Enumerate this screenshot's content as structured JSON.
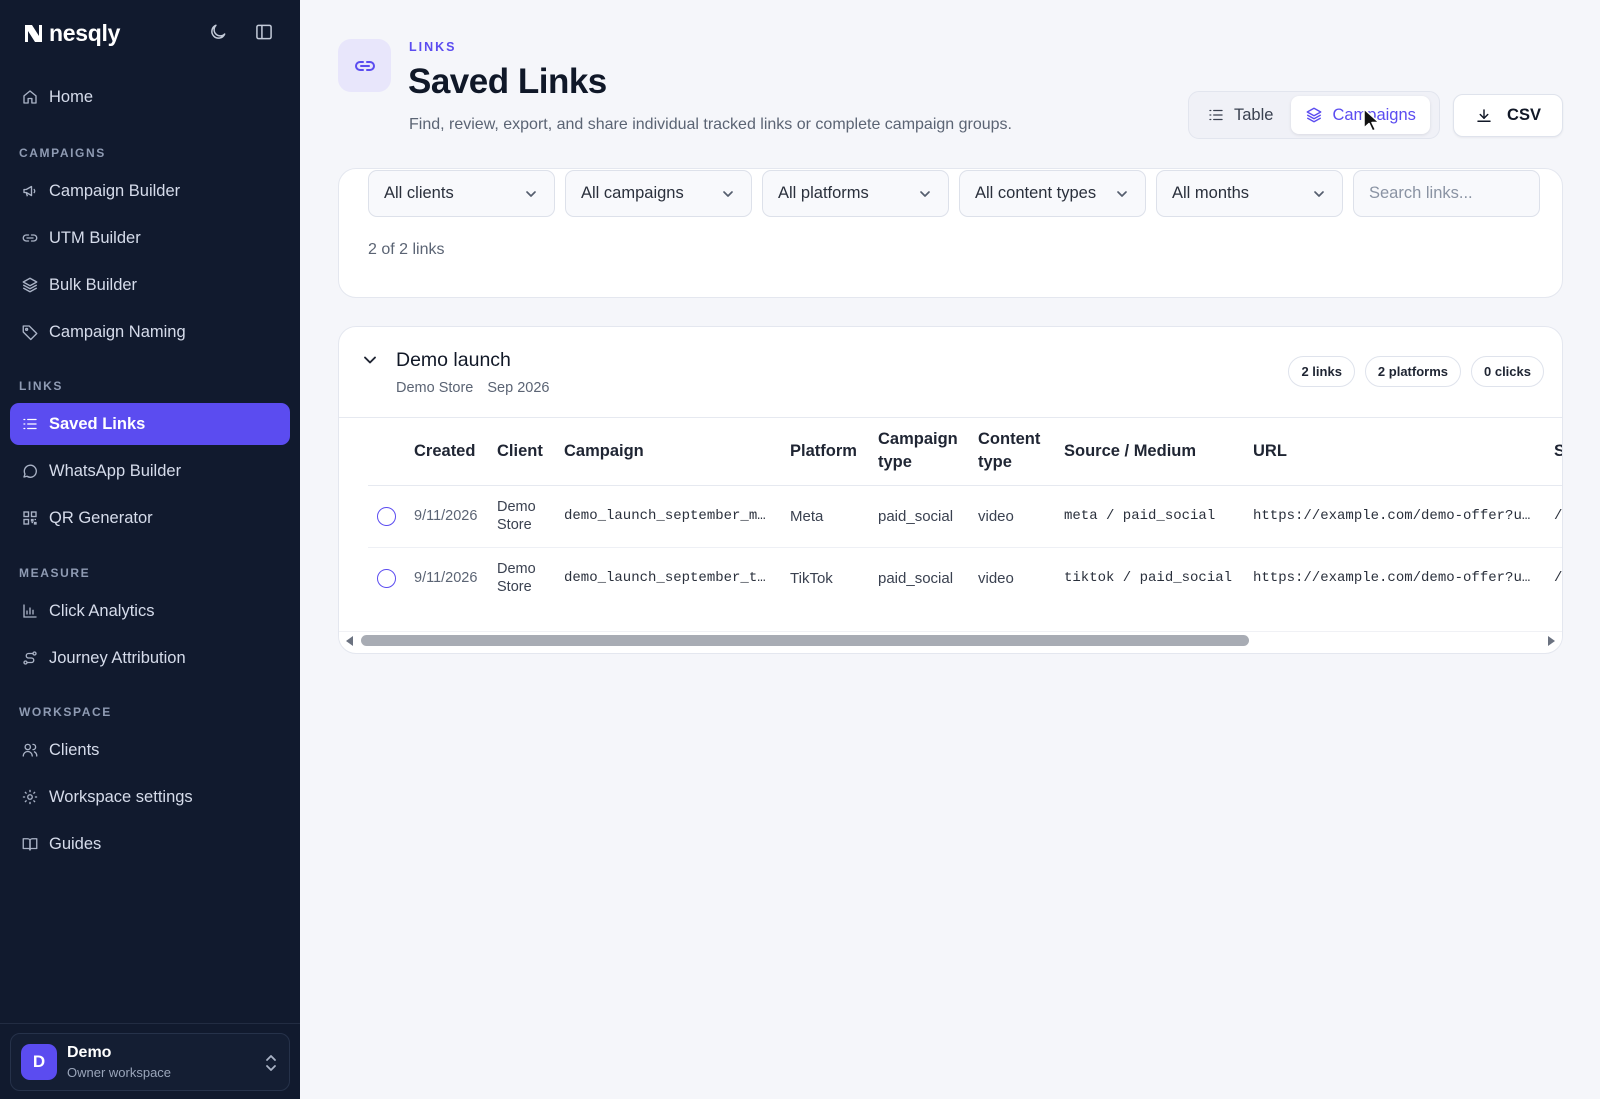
{
  "brand": {
    "name": "nesqly"
  },
  "sidebar": {
    "home": "Home",
    "sections": [
      {
        "label": "CAMPAIGNS",
        "items": [
          {
            "label": "Campaign Builder",
            "icon": "megaphone-icon"
          },
          {
            "label": "UTM Builder",
            "icon": "link-icon"
          },
          {
            "label": "Bulk Builder",
            "icon": "layers-icon"
          },
          {
            "label": "Campaign Naming",
            "icon": "tag-icon"
          }
        ]
      },
      {
        "label": "LINKS",
        "items": [
          {
            "label": "Saved Links",
            "icon": "list-icon",
            "active": true
          },
          {
            "label": "WhatsApp Builder",
            "icon": "chat-bubble-icon"
          },
          {
            "label": "QR Generator",
            "icon": "qr-code-icon"
          }
        ]
      },
      {
        "label": "MEASURE",
        "items": [
          {
            "label": "Click Analytics",
            "icon": "bar-chart-icon"
          },
          {
            "label": "Journey Attribution",
            "icon": "route-icon"
          }
        ]
      },
      {
        "label": "WORKSPACE",
        "items": [
          {
            "label": "Clients",
            "icon": "users-icon"
          },
          {
            "label": "Workspace settings",
            "icon": "gear-icon"
          },
          {
            "label": "Guides",
            "icon": "book-icon"
          }
        ]
      }
    ],
    "workspace": {
      "initial": "D",
      "name": "Demo",
      "role": "Owner workspace"
    }
  },
  "header": {
    "eyebrow": "LINKS",
    "title": "Saved Links",
    "subtitle": "Find, review, export, and share individual tracked links or complete campaign groups.",
    "view_table": "Table",
    "view_campaigns": "Campaigns",
    "active_view": "Campaigns",
    "csv": "CSV"
  },
  "filters": {
    "clients": "All clients",
    "campaigns": "All campaigns",
    "platforms": "All platforms",
    "content_types": "All content types",
    "months": "All months",
    "search_placeholder": "Search links...",
    "count": "2 of 2 links"
  },
  "group": {
    "title": "Demo launch",
    "client": "Demo Store",
    "month": "Sep 2026",
    "badge_links": "2 links",
    "badge_platforms": "2 platforms",
    "badge_clicks": "0 clicks",
    "columns": {
      "created": "Created",
      "client": "Client",
      "campaign": "Campaign",
      "platform": "Platform",
      "campaign_type": "Campaign type",
      "content_type": "Content type",
      "source_medium": "Source / Medium",
      "url": "URL",
      "next": "S"
    },
    "rows": [
      {
        "created": "9/11/2026",
        "client": "Demo Store",
        "campaign": "demo_launch_september_m…",
        "platform": "Meta",
        "campaign_type": "paid_social",
        "content_type": "video",
        "source_medium": "meta / paid_social",
        "url": "https://example.com/demo-offer?u…",
        "next": "/"
      },
      {
        "created": "9/11/2026",
        "client": "Demo Store",
        "campaign": "demo_launch_september_t…",
        "platform": "TikTok",
        "campaign_type": "paid_social",
        "content_type": "video",
        "source_medium": "tiktok / paid_social",
        "url": "https://example.com/demo-offer?u…",
        "next": "/"
      }
    ]
  },
  "colors": {
    "accent": "#5b4cf0",
    "sidebar_bg": "#111a2e",
    "page_bg": "#f5f6fa"
  }
}
